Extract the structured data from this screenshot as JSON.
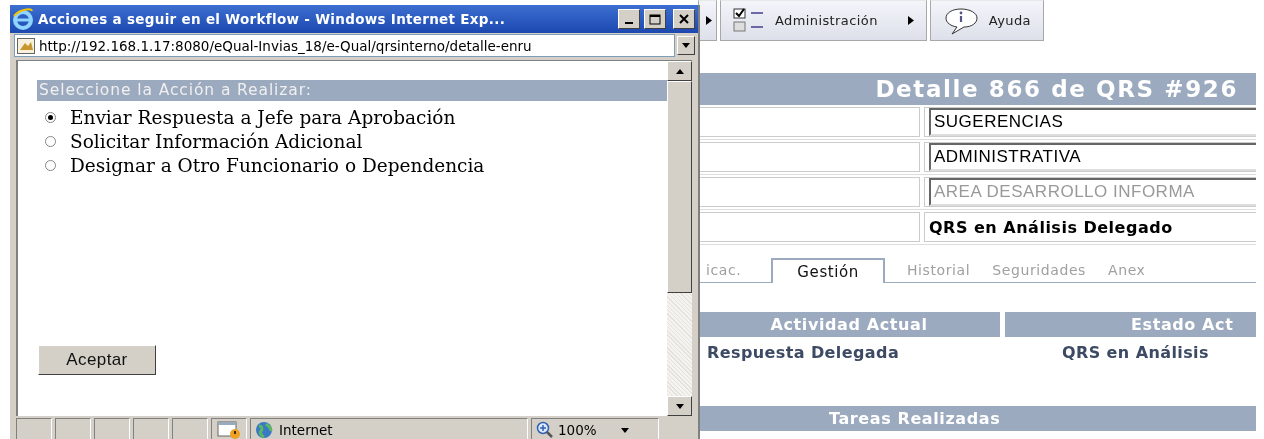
{
  "toolbar": {
    "items": [
      {
        "label": "Administración",
        "kind": "menu"
      },
      {
        "label": "Ayuda",
        "kind": "help"
      }
    ]
  },
  "page": {
    "title": "Detalle 866 de QRS #926",
    "fields": [
      {
        "value": "SUGERENCIAS",
        "kind": "input",
        "disabled": false
      },
      {
        "value": "ADMINISTRATIVA",
        "kind": "input",
        "disabled": false
      },
      {
        "value": "AREA DESARROLLO INFORMA",
        "kind": "input",
        "disabled": true
      },
      {
        "value": "QRS en Análisis Delegado",
        "kind": "text",
        "disabled": false
      }
    ],
    "tabs": [
      {
        "label": "icac.",
        "selected": false
      },
      {
        "label": "Gestión",
        "selected": true
      },
      {
        "label": "Historial",
        "selected": false
      },
      {
        "label": "Seguridades",
        "selected": false
      },
      {
        "label": "Anex",
        "selected": false
      }
    ],
    "activity": {
      "columns": [
        "Actividad Actual",
        "Estado Act"
      ],
      "values": [
        "Respuesta Delegada",
        "QRS en Análisis"
      ]
    },
    "tasks_heading": "Tareas Realizadas"
  },
  "popup": {
    "title": "Acciones a seguir en el Workflow - Windows Internet Exp...",
    "address": "http://192.168.1.17:8080/eQual-Invias_18/e-Qual/qrsinterno/detalle-enru",
    "heading": "Seleccione la Acción a Realizar:",
    "options": [
      {
        "label": "Enviar Respuesta a Jefe para Aprobación",
        "selected": true
      },
      {
        "label": "Solicitar Información Adicional",
        "selected": false
      },
      {
        "label": "Designar a Otro Funcionario o Dependencia",
        "selected": false
      }
    ],
    "button": "Aceptar",
    "status": {
      "zone": "Internet",
      "zoom": "100%"
    }
  }
}
